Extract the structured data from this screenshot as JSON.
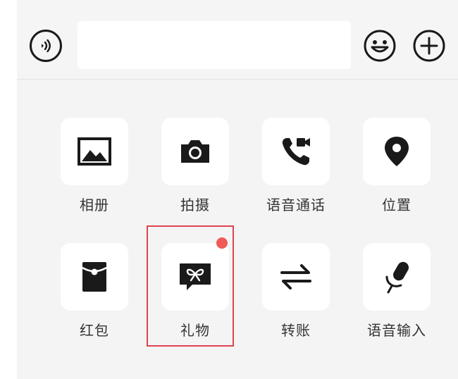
{
  "input_bar": {
    "voice_icon": "voice-icon",
    "text_value": "",
    "emoji_icon": "emoji-icon",
    "plus_icon": "plus-icon"
  },
  "actions": [
    {
      "label": "相册",
      "icon": "photo-album-icon"
    },
    {
      "label": "拍摄",
      "icon": "camera-icon"
    },
    {
      "label": "语音通话",
      "icon": "voice-video-call-icon"
    },
    {
      "label": "位置",
      "icon": "location-pin-icon"
    },
    {
      "label": "红包",
      "icon": "red-envelope-icon"
    },
    {
      "label": "礼物",
      "icon": "gift-icon",
      "badge": true,
      "highlighted": true
    },
    {
      "label": "转账",
      "icon": "transfer-icon"
    },
    {
      "label": "语音输入",
      "icon": "microphone-icon"
    }
  ],
  "colors": {
    "icon": "#1a1a1a",
    "panel_bg": "#f4f4f4",
    "tile_bg": "#ffffff",
    "highlight": "#e0434d",
    "badge": "#ee5a5a"
  }
}
